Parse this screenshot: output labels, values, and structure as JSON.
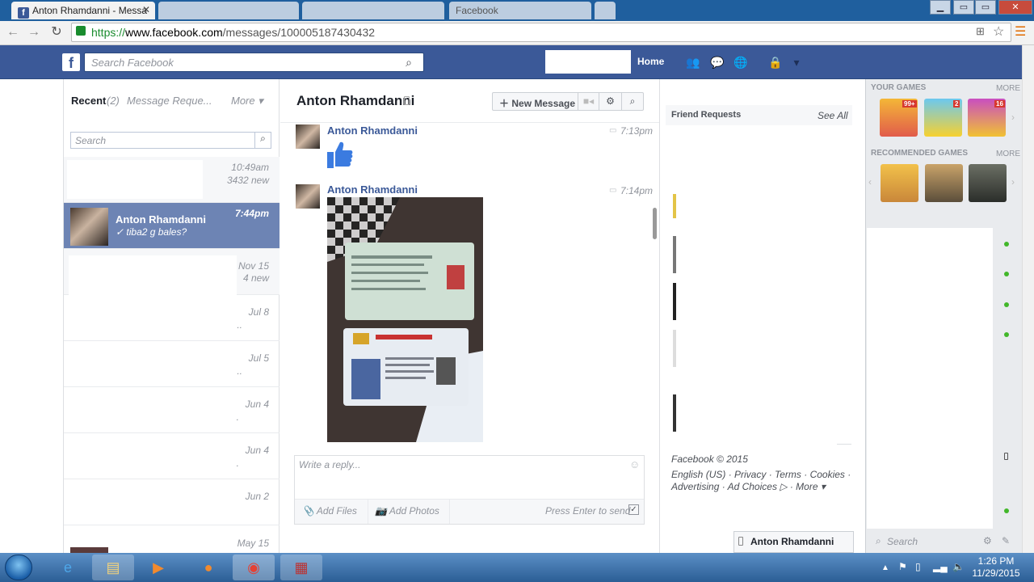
{
  "browser": {
    "active_tab_title": "Anton Rhamdanni - Messa",
    "tab2_title": "",
    "tab3_title": "",
    "tab4_title": "",
    "tab5_title": "Facebook",
    "url_scheme": "https://",
    "url_host": "www.facebook.com",
    "url_path": "/messages/100005187430432"
  },
  "fb": {
    "search_placeholder": "Search Facebook",
    "home_label": "Home",
    "brand_color": "#3b5998"
  },
  "inbox": {
    "recent_label": "Recent",
    "recent_count": "(2)",
    "message_requests": "Message Reque...",
    "more_label": "More",
    "search_placeholder": "Search",
    "threads": [
      {
        "time": "10:49am",
        "sub": "3432 new"
      },
      {
        "name": "Anton Rhamdanni",
        "time": "7:44pm",
        "snippet": "✓ tiba2 g bales?"
      },
      {
        "time": "Nov 15",
        "sub": "4 new"
      },
      {
        "time": "Jul 8",
        "sub": ".."
      },
      {
        "time": "Jul 5",
        "sub": ".."
      },
      {
        "time": "Jun 4",
        "sub": "."
      },
      {
        "time": "Jun 4",
        "sub": "."
      },
      {
        "time": "Jun 2",
        "sub": ""
      },
      {
        "time": "May 15",
        "sub": ""
      }
    ]
  },
  "conversation": {
    "title": "Anton Rhamdanni",
    "new_message_label": "New Message",
    "messages": [
      {
        "sender": "Anton Rhamdanni",
        "time": "7:13pm"
      },
      {
        "sender": "Anton Rhamdanni",
        "time": "7:14pm"
      }
    ],
    "reply_placeholder": "Write a reply...",
    "add_files": "Add Files",
    "add_photos": "Add Photos",
    "press_enter": "Press Enter to send"
  },
  "right": {
    "friend_requests": "Friend Requests",
    "see_all": "See All",
    "footer_copy": "Facebook © 2015",
    "footer_links": "English (US) · Privacy · Terms · Cookies · Advertising · Ad Choices ▷ · More ▾",
    "chat_tab_name": "Anton Rhamdanni"
  },
  "sidebar": {
    "your_games": "YOUR GAMES",
    "recommended_games": "RECOMMENDED GAMES",
    "more": "MORE",
    "chat_search": "Search",
    "badge1": "99+",
    "badge2": "2",
    "badge3": "16"
  },
  "taskbar": {
    "time": "1:26 PM",
    "date": "11/29/2015"
  }
}
